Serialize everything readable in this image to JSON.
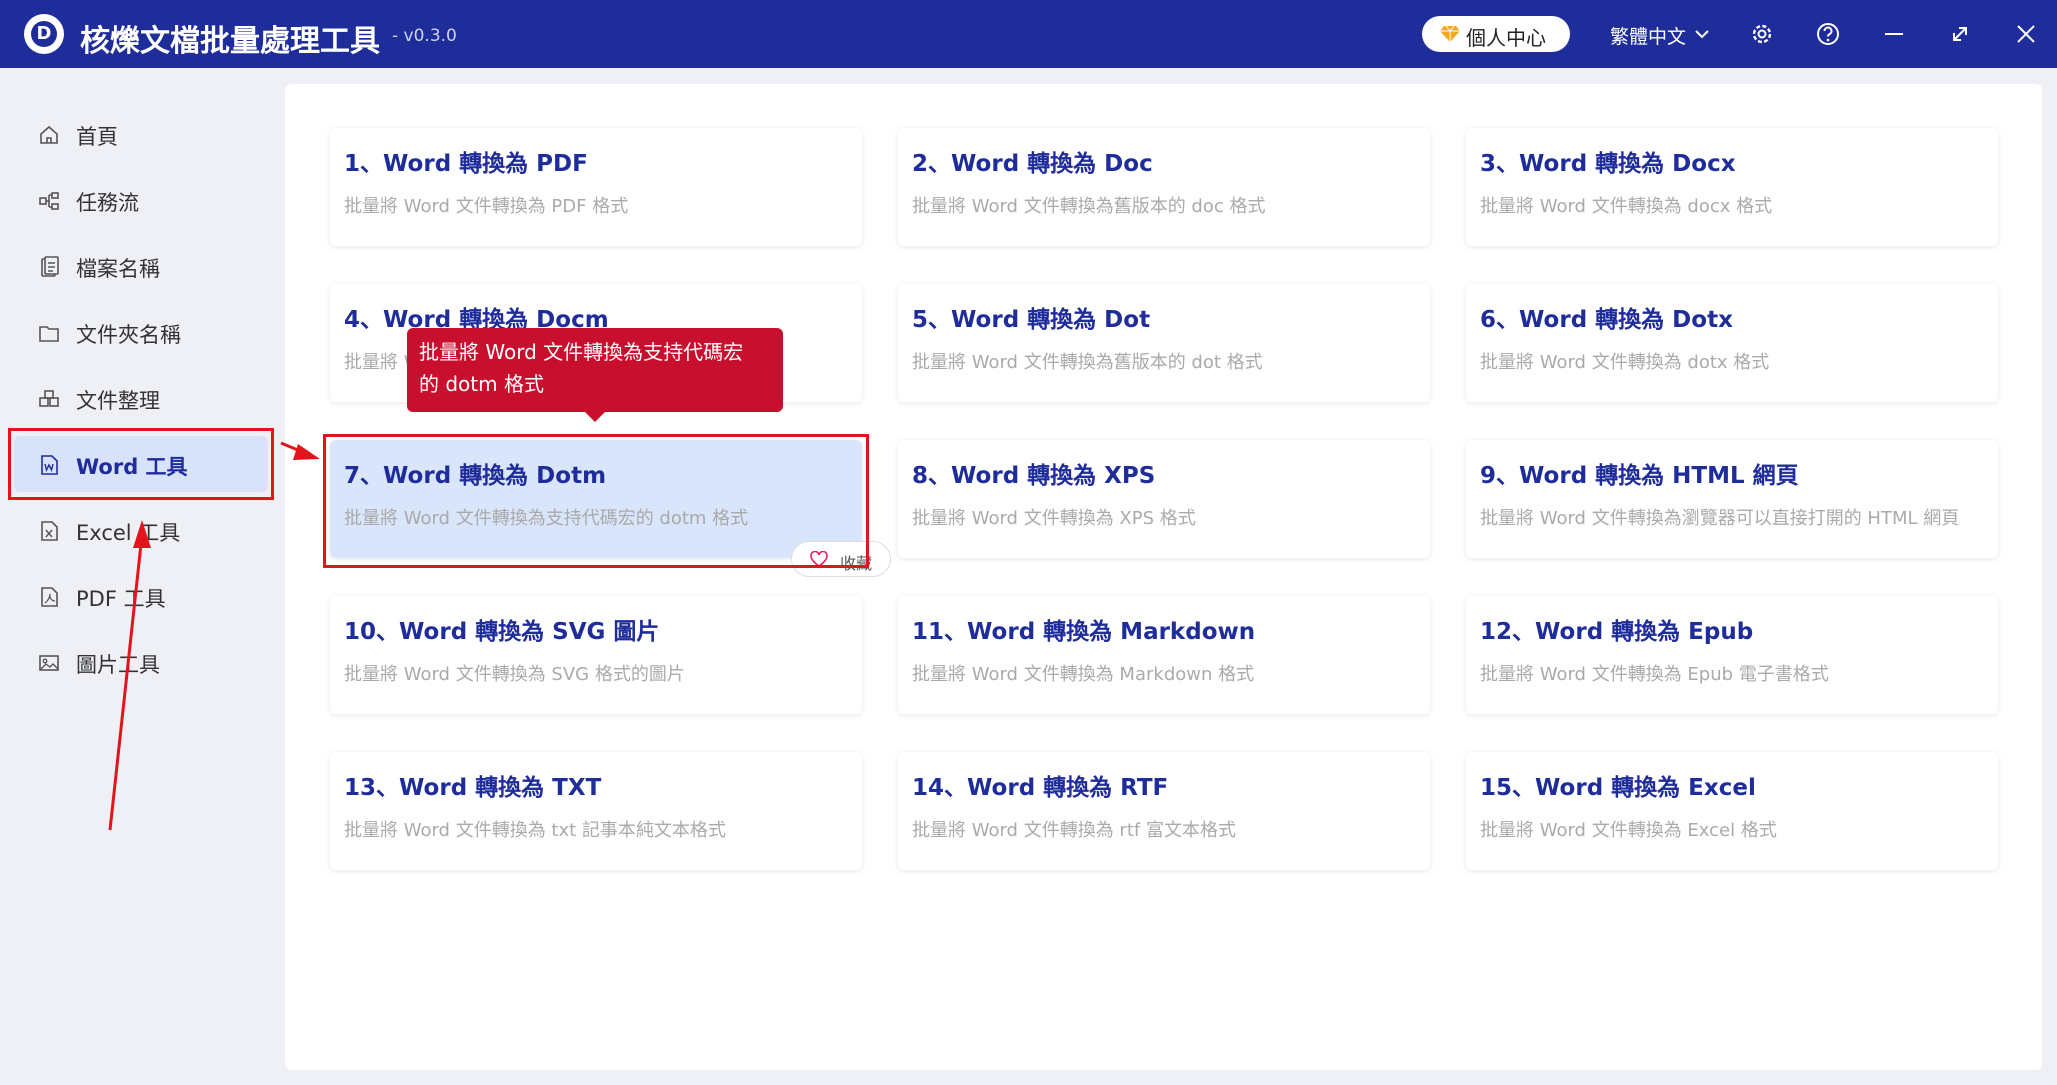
{
  "app": {
    "logo_letter": "D",
    "title": "核爍文檔批量處理工具",
    "version": "- v0.3.0",
    "vip_label": "個人中心",
    "language": "繁體中文"
  },
  "titlebar_icons": [
    "gear-icon",
    "help-icon",
    "minimize-icon",
    "maximize-icon",
    "close-icon"
  ],
  "sidebar": {
    "items": [
      {
        "label": "首頁",
        "icon": "home-icon"
      },
      {
        "label": "任務流",
        "icon": "workflow-icon"
      },
      {
        "label": "檔案名稱",
        "icon": "file-name-icon"
      },
      {
        "label": "文件夾名稱",
        "icon": "folder-icon"
      },
      {
        "label": "文件整理",
        "icon": "organize-icon"
      },
      {
        "label": "Word 工具",
        "icon": "word-icon"
      },
      {
        "label": "Excel 工具",
        "icon": "excel-icon"
      },
      {
        "label": "PDF 工具",
        "icon": "pdf-icon"
      },
      {
        "label": "圖片工具",
        "icon": "image-icon"
      }
    ],
    "active_index": 5
  },
  "cards": [
    {
      "title": "1、Word 轉換為 PDF",
      "desc": "批量將 Word 文件轉換為 PDF 格式"
    },
    {
      "title": "2、Word 轉換為 Doc",
      "desc": "批量將 Word 文件轉換為舊版本的 doc 格式"
    },
    {
      "title": "3、Word 轉換為 Docx",
      "desc": "批量將 Word 文件轉換為 docx 格式"
    },
    {
      "title": "4、Word 轉換為 Docm",
      "desc": "批量將 Word 文件轉換為 docm 格式"
    },
    {
      "title": "5、Word 轉換為 Dot",
      "desc": "批量將 Word 文件轉換為舊版本的 dot 格式"
    },
    {
      "title": "6、Word 轉換為 Dotx",
      "desc": "批量將 Word 文件轉換為 dotx 格式"
    },
    {
      "title": "7、Word 轉換為 Dotm",
      "desc": "批量將 Word 文件轉換為支持代碼宏的 dotm 格式"
    },
    {
      "title": "8、Word 轉換為 XPS",
      "desc": "批量將 Word 文件轉換為 XPS 格式"
    },
    {
      "title": "9、Word 轉換為 HTML 網頁",
      "desc": "批量將 Word 文件轉換為瀏覽器可以直接打開的 HTML 網頁"
    },
    {
      "title": "10、Word 轉換為 SVG 圖片",
      "desc": "批量將 Word 文件轉換為 SVG 格式的圖片"
    },
    {
      "title": "11、Word 轉換為 Markdown",
      "desc": "批量將 Word 文件轉換為 Markdown 格式"
    },
    {
      "title": "12、Word 轉換為 Epub",
      "desc": "批量將 Word 文件轉換為 Epub 電子書格式"
    },
    {
      "title": "13、Word 轉換為 TXT",
      "desc": "批量將 Word 文件轉換為 txt 記事本純文本格式"
    },
    {
      "title": "14、Word 轉換為 RTF",
      "desc": "批量將 Word 文件轉換為 rtf 富文本格式"
    },
    {
      "title": "15、Word 轉換為 Excel",
      "desc": "批量將 Word 文件轉換為 Excel 格式"
    }
  ],
  "highlighted_card_index": 6,
  "tooltip": {
    "line1": "批量將 Word 文件轉換為支持代碼宏",
    "line2": "的 dotm 格式"
  },
  "favorite_label": "收藏",
  "colors": {
    "titlebar": "#1f2d9b",
    "accent": "#1f2d9b",
    "highlight": "#d9e5fb",
    "tooltip": "#c8102e",
    "annotation": "#e3141b"
  }
}
